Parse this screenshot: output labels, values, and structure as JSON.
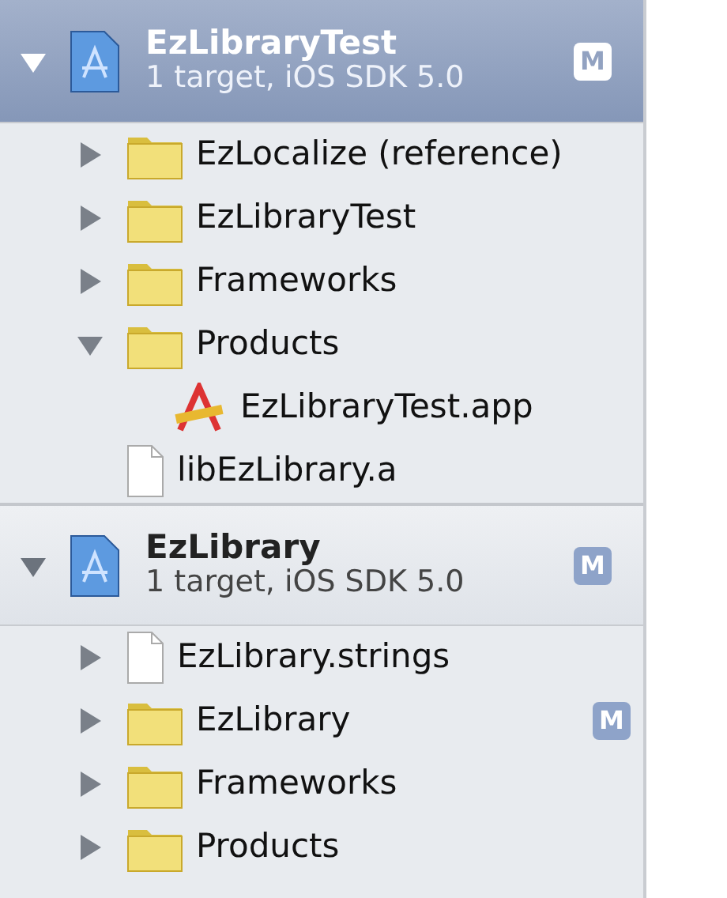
{
  "projects": [
    {
      "name": "EzLibraryTest",
      "subtitle": "1 target, iOS SDK 5.0",
      "badge": "M",
      "selected": true,
      "expanded": true,
      "children": [
        {
          "kind": "folder",
          "name": "EzLocalize (reference)",
          "expanded": false
        },
        {
          "kind": "folder",
          "name": "EzLibraryTest",
          "expanded": false
        },
        {
          "kind": "folder",
          "name": "Frameworks",
          "expanded": false
        },
        {
          "kind": "folder",
          "name": "Products",
          "expanded": true,
          "children": [
            {
              "kind": "app",
              "name": "EzLibraryTest.app"
            }
          ]
        },
        {
          "kind": "file",
          "name": "libEzLibrary.a"
        }
      ]
    },
    {
      "name": "EzLibrary",
      "subtitle": "1 target, iOS SDK 5.0",
      "badge": "M",
      "selected": false,
      "expanded": true,
      "children": [
        {
          "kind": "file",
          "name": "EzLibrary.strings",
          "expanded": false
        },
        {
          "kind": "folder",
          "name": "EzLibrary",
          "badge": "M",
          "expanded": false
        },
        {
          "kind": "folder",
          "name": "Frameworks",
          "expanded": false
        },
        {
          "kind": "folder",
          "name": "Products",
          "expanded": false
        }
      ]
    }
  ]
}
